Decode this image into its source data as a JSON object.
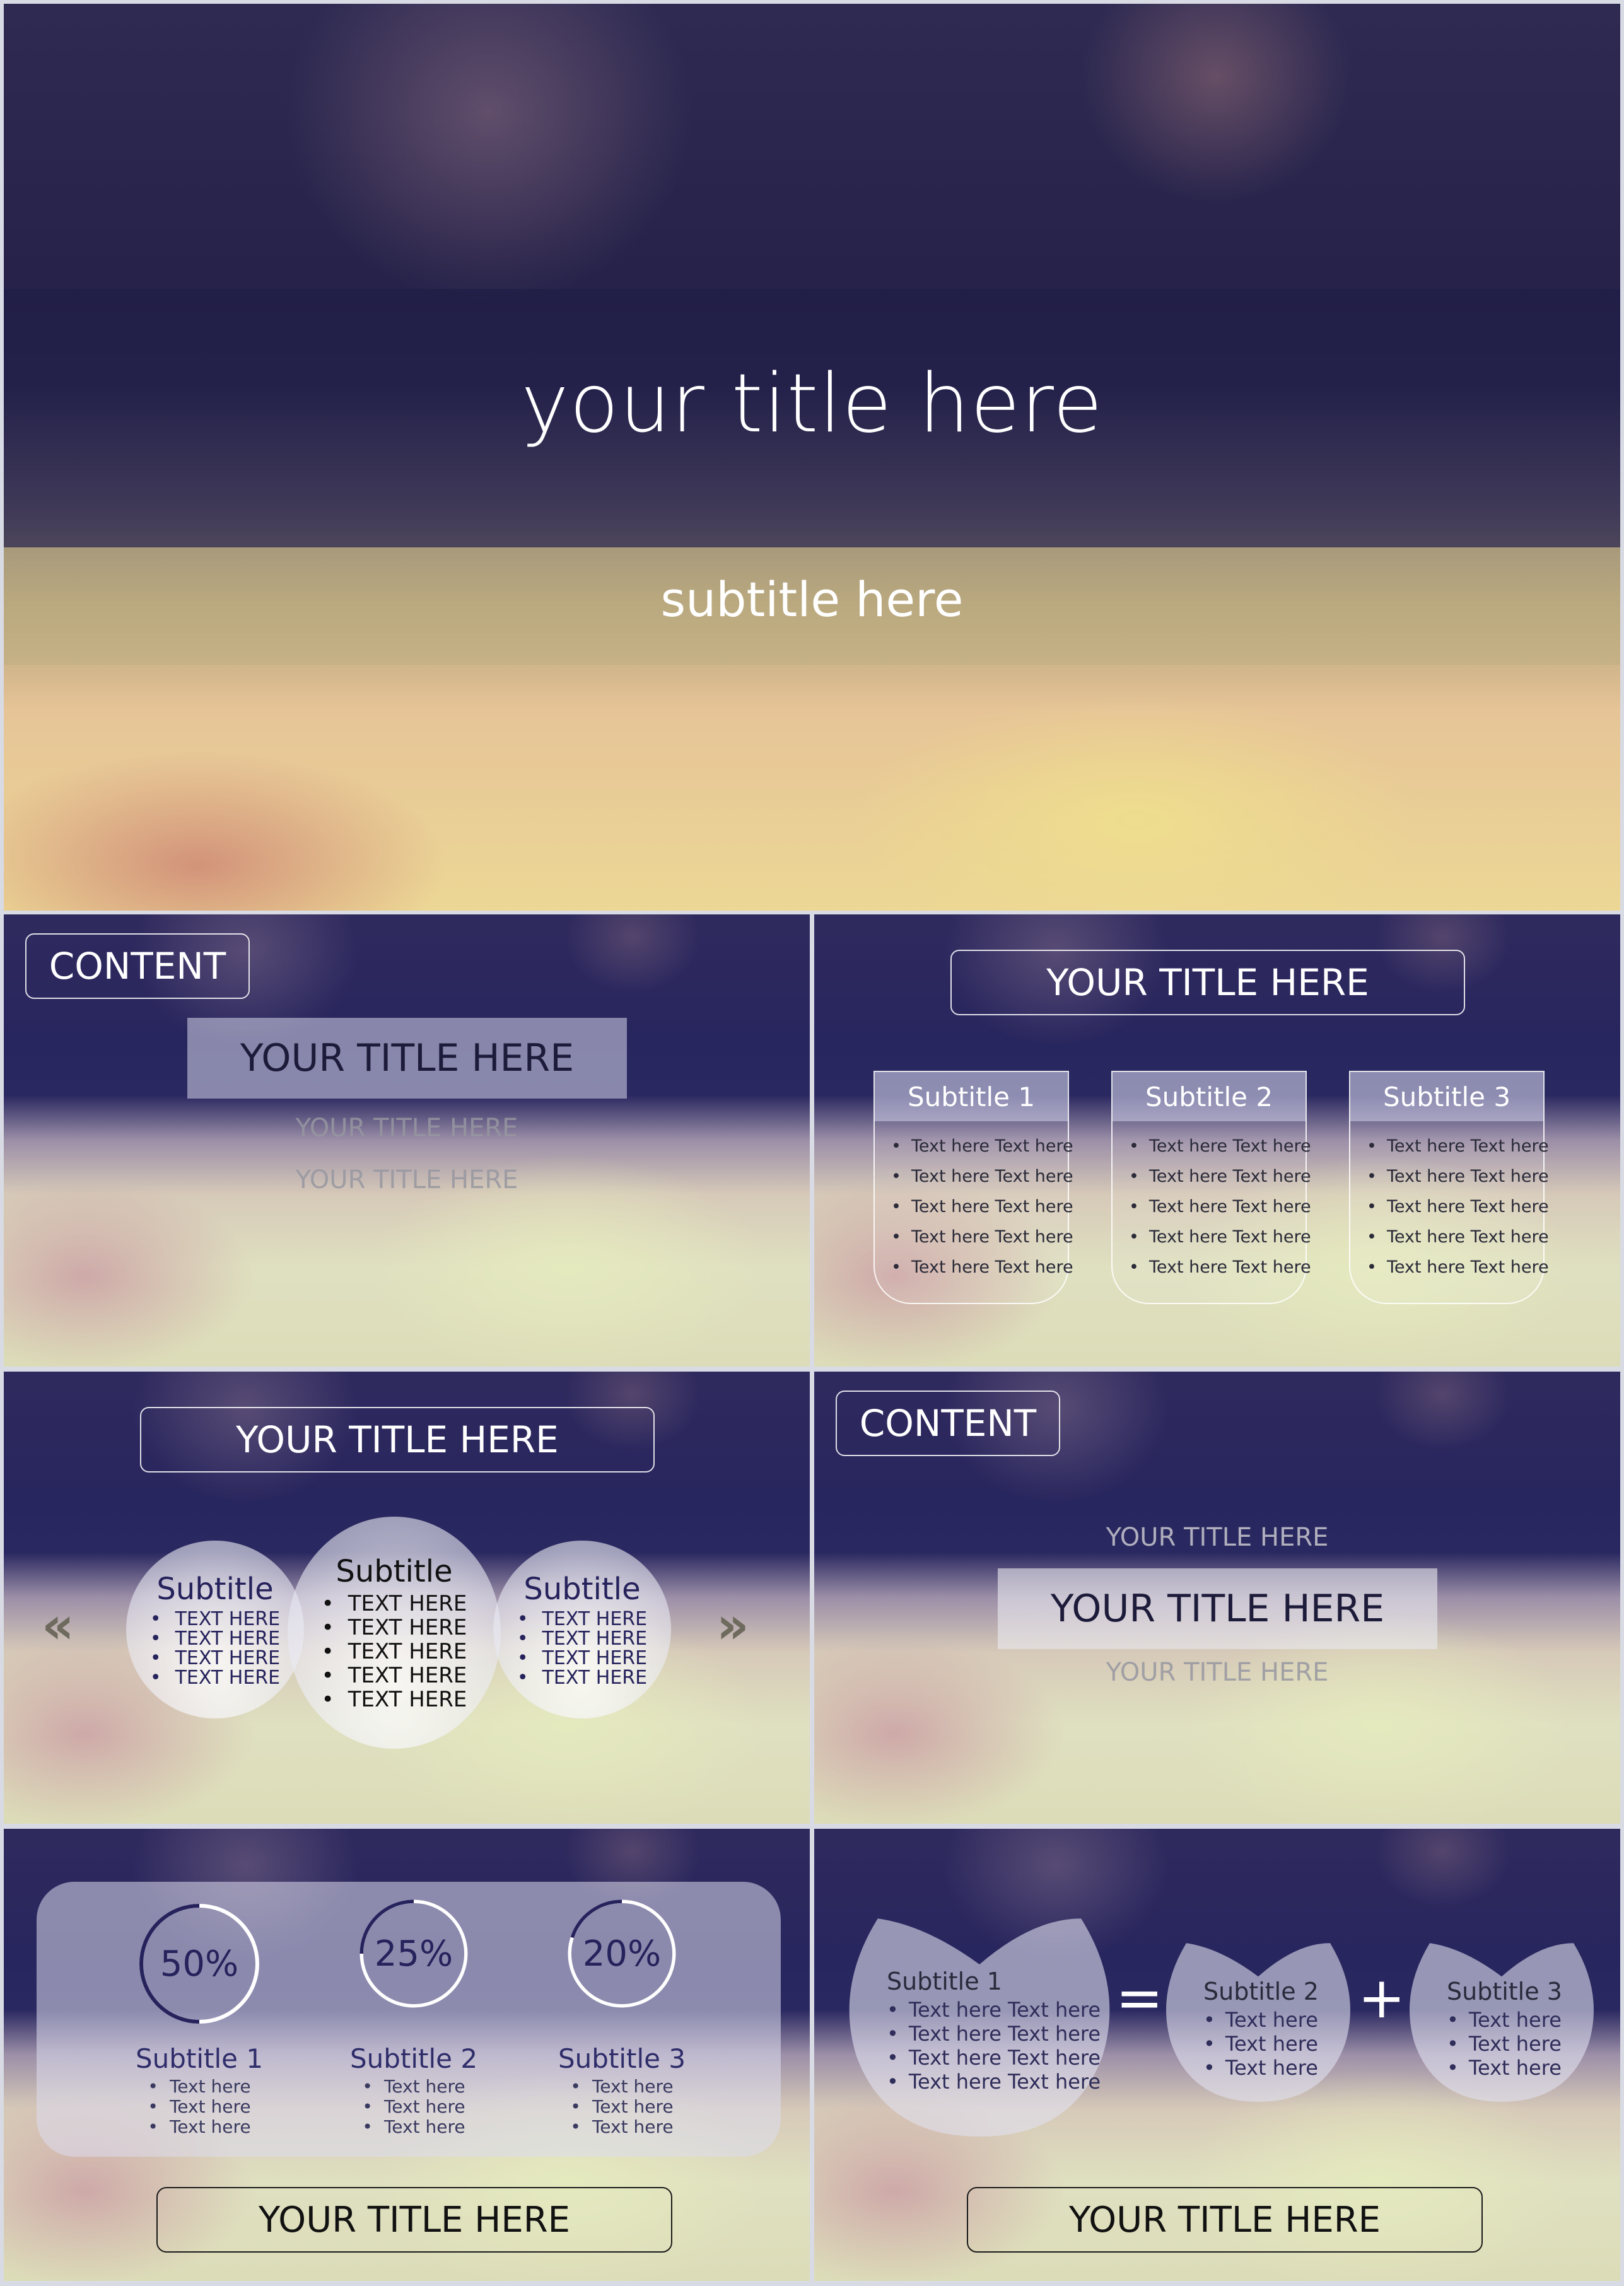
{
  "slides": [
    {
      "id": "cover",
      "title": "your title here",
      "subtitle": "subtitle here"
    },
    {
      "id": "content-list",
      "tag": "CONTENT",
      "active_title": "YOUR TITLE HERE",
      "faded_titles": [
        "YOUR TITLE HERE",
        "YOUR TITLE HERE"
      ]
    },
    {
      "id": "three-cards",
      "title": "YOUR TITLE HERE",
      "cards": [
        {
          "heading": "Subtitle 1",
          "items": [
            "Text here Text here",
            "Text here Text here",
            "Text here Text here",
            "Text here Text here",
            "Text here Text here"
          ]
        },
        {
          "heading": "Subtitle 2",
          "items": [
            "Text here Text here",
            "Text here Text here",
            "Text here Text here",
            "Text here Text here",
            "Text here Text here"
          ]
        },
        {
          "heading": "Subtitle 3",
          "items": [
            "Text here Text here",
            "Text here Text here",
            "Text here Text here",
            "Text here Text here",
            "Text here Text here"
          ]
        }
      ]
    },
    {
      "id": "bubbles",
      "title": "YOUR TITLE HERE",
      "prev_icon": "«",
      "next_icon": "»",
      "bubbles": [
        {
          "heading": "Subtitle",
          "items": [
            "TEXT HERE",
            "TEXT HERE",
            "TEXT HERE",
            "TEXT HERE"
          ]
        },
        {
          "heading": "Subtitle",
          "items": [
            "TEXT HERE",
            "TEXT HERE",
            "TEXT HERE",
            "TEXT HERE",
            "TEXT HERE"
          ]
        },
        {
          "heading": "Subtitle",
          "items": [
            "TEXT HERE",
            "TEXT HERE",
            "TEXT HERE",
            "TEXT HERE"
          ]
        }
      ]
    },
    {
      "id": "content-list-2",
      "tag": "CONTENT",
      "faded_title_top": "YOUR TITLE HERE",
      "active_title": "YOUR TITLE HERE",
      "faded_title_bottom": "YOUR TITLE HERE"
    },
    {
      "id": "percent-stats",
      "stats": [
        {
          "label": "50%",
          "percent": 50,
          "heading": "Subtitle 1",
          "items": [
            "Text here",
            "Text here",
            "Text here"
          ]
        },
        {
          "label": "25%",
          "percent": 25,
          "heading": "Subtitle 2",
          "items": [
            "Text here",
            "Text here",
            "Text here"
          ]
        },
        {
          "label": "20%",
          "percent": 20,
          "heading": "Subtitle 3",
          "items": [
            "Text here",
            "Text here",
            "Text here"
          ]
        }
      ],
      "footer_title": "YOUR TITLE HERE"
    },
    {
      "id": "equation",
      "equals": "=",
      "plus": "+",
      "petals": [
        {
          "heading": "Subtitle 1",
          "items": [
            "Text here Text here",
            "Text here Text here",
            "Text here Text here",
            "Text here Text here"
          ]
        },
        {
          "heading": "Subtitle 2",
          "items": [
            "Text here",
            "Text here",
            "Text here"
          ]
        },
        {
          "heading": "Subtitle 3",
          "items": [
            "Text here",
            "Text here",
            "Text here"
          ]
        }
      ],
      "footer_title": "YOUR TITLE HERE"
    }
  ],
  "colors": {
    "ring_fill": "#25225c",
    "ring_track": "#ffffff",
    "text_dark": "#1d1b3a"
  }
}
